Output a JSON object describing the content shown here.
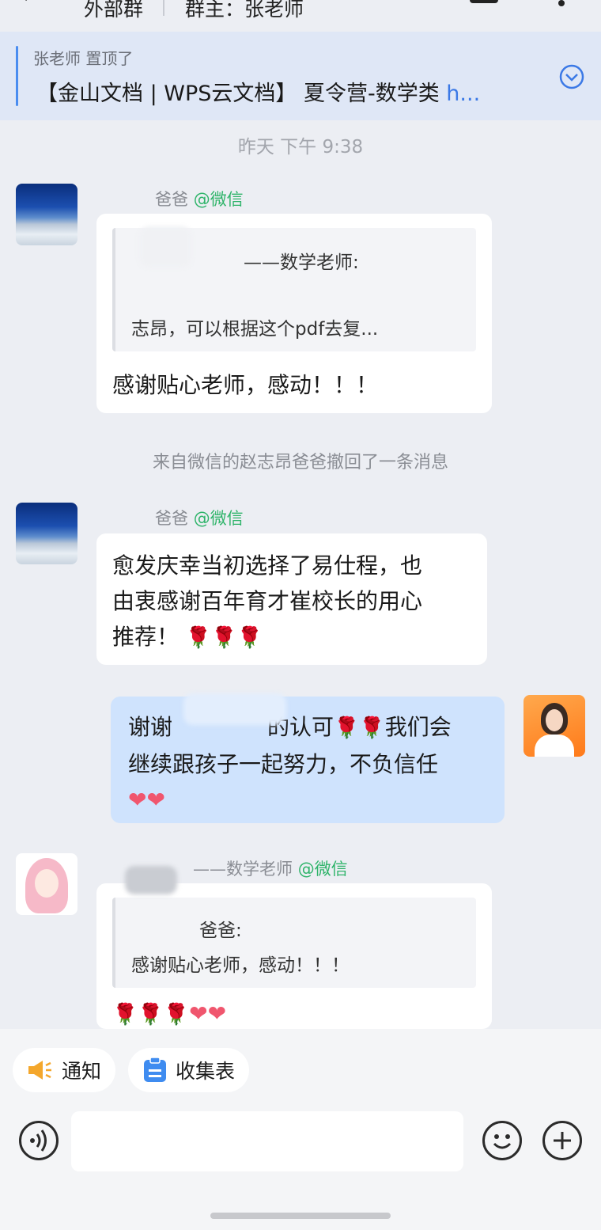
{
  "header": {
    "title": "外部群",
    "owner": "群主：张老师"
  },
  "pinned": {
    "pinned_by": "张老师 置顶了",
    "text": "【金山文档 | WPS云文档】 夏令营-数学类",
    "link": " h..."
  },
  "chat": {
    "timestamp": "昨天 下午 9:38",
    "messages": [
      {
        "sender": "爸爸",
        "tag": "@微信",
        "quote_author": "——数学老师:",
        "quote_text": "志昂，可以根据这个pdf去复...",
        "text": "感谢贴心老师，感动！！！"
      },
      {
        "sender": "爸爸",
        "tag": "@微信",
        "text_lines": [
          "愈发庆幸当初选择了易仕程，也",
          "由衷感谢百年育才崔校长的用心",
          "推荐！"
        ]
      },
      {
        "text_lines": [
          "谢谢",
          "的认可",
          "我们会",
          "继续跟孩子一起努力，不负信任"
        ]
      },
      {
        "sender": "——数学老师",
        "tag": "@微信",
        "quote_author": "爸爸:",
        "quote_text": "感谢贴心老师，感动！！！"
      }
    ],
    "system_message": "来自微信的赵志昂爸爸撤回了一条消息"
  },
  "quick_actions": {
    "notify": "通知",
    "form": "收集表"
  },
  "colors": {
    "accent": "#3b79e6",
    "wechat_tag": "#2fb46a",
    "my_bubble": "#cfe3fd"
  }
}
